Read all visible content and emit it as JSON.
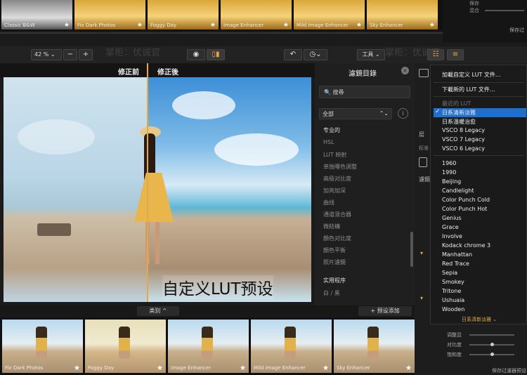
{
  "top_presets": [
    {
      "label": "Classic B&W",
      "style": "bw"
    },
    {
      "label": "Fix Dark Photos",
      "style": "warm"
    },
    {
      "label": "Foggy Day",
      "style": "warm"
    },
    {
      "label": "Image Enhancer",
      "style": "warm"
    },
    {
      "label": "Mild Image Enhancer",
      "style": "warm"
    },
    {
      "label": "Sky Enhancer",
      "style": "warm"
    }
  ],
  "top_right": {
    "label1": "保存",
    "label2": "混合",
    "save": "保存过"
  },
  "toolbar": {
    "zoom": "42 %",
    "minus": "−",
    "plus": "+",
    "tools": "工具",
    "watermark": "掌柜：优诚官"
  },
  "compare": {
    "before": "修正前",
    "after": "修正後"
  },
  "caption": "自定义LUT预设",
  "filter_panel": {
    "title": "濾鏡目錄",
    "search_placeholder": "搜尋",
    "select_value": "全部",
    "section_pro": "专业的",
    "items": [
      "HSL",
      "LUT 映射",
      "单独曝色调整",
      "高级对比度",
      "加亮加深",
      "曲线",
      "通道混合器",
      "微結構",
      "顏色对比度",
      "顏色平衡",
      "照片濾鏡"
    ],
    "section_util": "实用程序",
    "util_items": [
      "白 / 黑"
    ]
  },
  "bottom_bar": {
    "category": "类别 ^",
    "add_preset": "+ 预设添加"
  },
  "bottom_presets": [
    {
      "label": "Fix Dark Photos"
    },
    {
      "label": "Foggy Day"
    },
    {
      "label": "Image Enhancer"
    },
    {
      "label": "Mild Image Enhancer"
    },
    {
      "label": "Sky Enhancer"
    }
  ],
  "right_panel": {
    "layer_label": "层",
    "std_label": "标准",
    "filter_label": "濾鏡",
    "slider_labels": [
      "调整显",
      "对比度",
      "饱和度"
    ],
    "save": "保存过濾器预设"
  },
  "lut_menu": {
    "load": "加載自定义 LUT 文件...",
    "download": "下載新的 LUT 文件...",
    "recent_header": "最近的 LUT",
    "recent": [
      "日系清新淡雅",
      "日系溫暖治愈",
      "VSCO 8 Legacy",
      "VSCO 7 Legacy",
      "VSCO 6 Legacy"
    ],
    "luts": [
      "1960",
      "1990",
      "Beijing",
      "Candlelight",
      "Color Punch Cold",
      "Color Punch Hot",
      "Genius",
      "Grace",
      "Involve",
      "Kodack chrome  3",
      "Manhattan",
      "Red Trace",
      "Sepia",
      "Smokey",
      "Tritone",
      "Ushuaia",
      "Wooden"
    ],
    "footer": "日系清新淡雅 ⌄"
  }
}
